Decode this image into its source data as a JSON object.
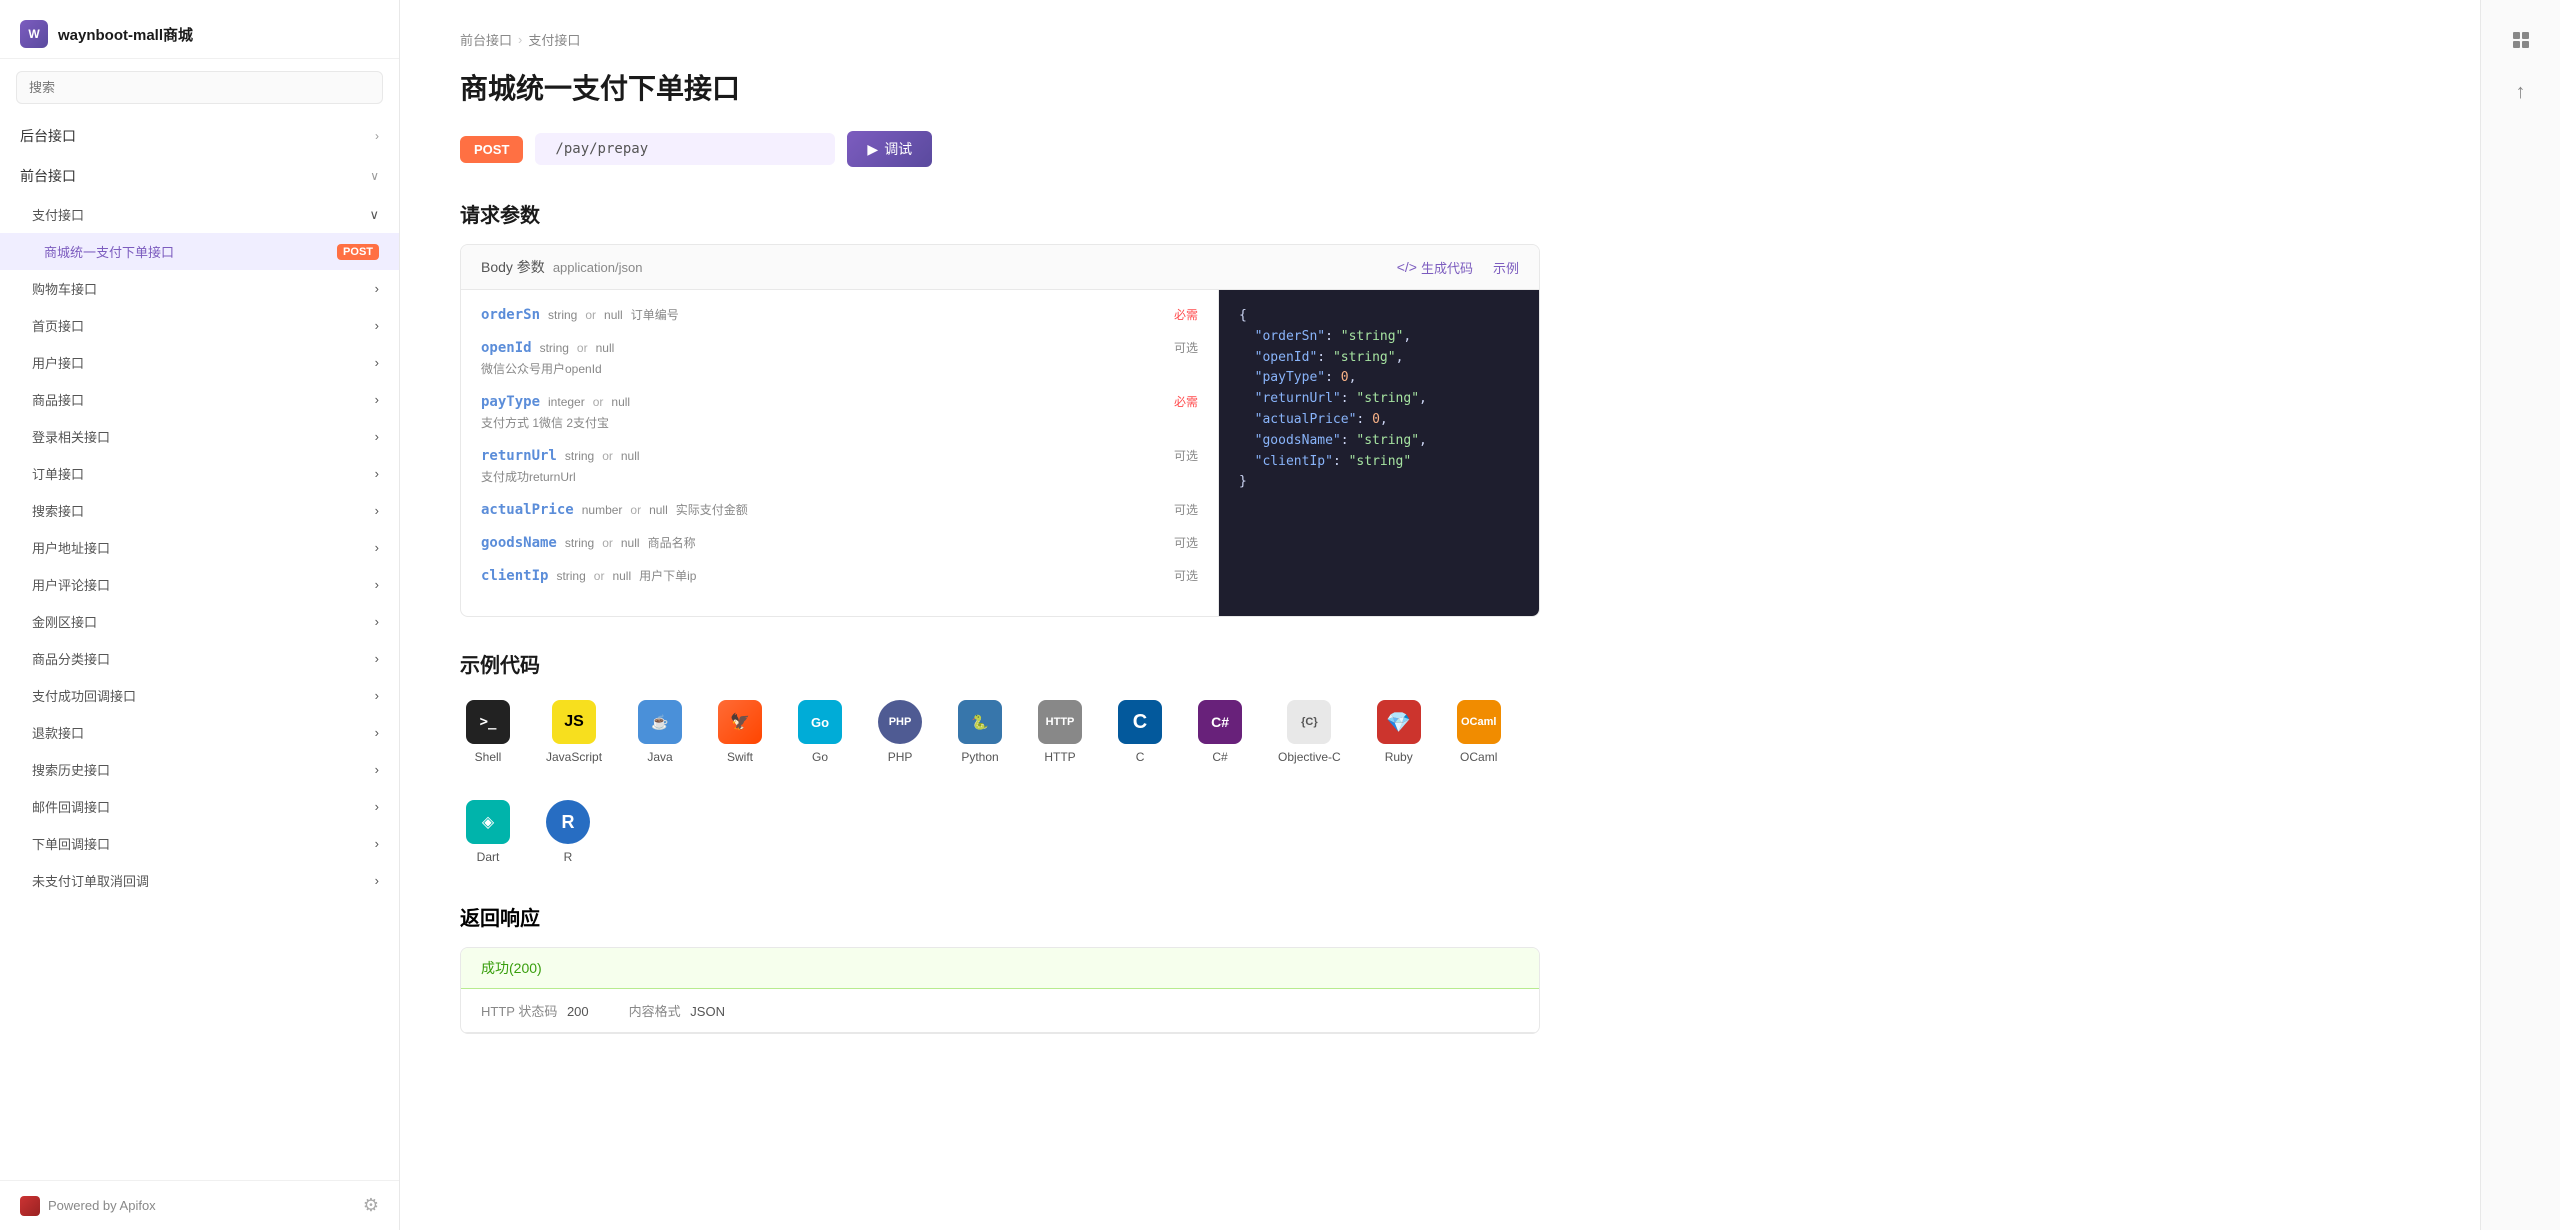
{
  "sidebar": {
    "title": "waynboot-mall商城",
    "logo_text": "W",
    "search_placeholder": "搜索",
    "nav_items": [
      {
        "label": "后台接口",
        "type": "top",
        "expanded": false
      },
      {
        "label": "前台接口",
        "type": "top",
        "expanded": true
      },
      {
        "label": "支付接口",
        "type": "sub",
        "expanded": true
      },
      {
        "label": "商城统一支付下单接口",
        "type": "leaf",
        "method": "POST"
      },
      {
        "label": "购物车接口",
        "type": "sub",
        "expanded": false
      },
      {
        "label": "首页接口",
        "type": "sub",
        "expanded": false
      },
      {
        "label": "用户接口",
        "type": "sub",
        "expanded": false
      },
      {
        "label": "商品接口",
        "type": "sub",
        "expanded": false
      },
      {
        "label": "登录相关接口",
        "type": "sub",
        "expanded": false
      },
      {
        "label": "订单接口",
        "type": "sub",
        "expanded": false
      },
      {
        "label": "搜索接口",
        "type": "sub",
        "expanded": false
      },
      {
        "label": "用户地址接口",
        "type": "sub",
        "expanded": false
      },
      {
        "label": "用户评论接口",
        "type": "sub",
        "expanded": false
      },
      {
        "label": "金刚区接口",
        "type": "sub",
        "expanded": false
      },
      {
        "label": "商品分类接口",
        "type": "sub",
        "expanded": false
      },
      {
        "label": "支付成功回调接口",
        "type": "sub",
        "expanded": false
      },
      {
        "label": "退款接口",
        "type": "sub",
        "expanded": false
      },
      {
        "label": "搜索历史接口",
        "type": "sub",
        "expanded": false
      },
      {
        "label": "邮件回调接口",
        "type": "sub",
        "expanded": false
      },
      {
        "label": "下单回调接口",
        "type": "sub",
        "expanded": false
      },
      {
        "label": "未支付订单取消回调",
        "type": "sub",
        "expanded": false
      }
    ],
    "footer": {
      "brand": "Powered by Apifox",
      "logo": "A"
    }
  },
  "breadcrumb": {
    "items": [
      "前台接口",
      "支付接口"
    ]
  },
  "page": {
    "title": "商城统一支付下单接口",
    "method": "POST",
    "url": "/pay/prepay",
    "debug_label": "调试"
  },
  "request_params": {
    "section_title": "请求参数",
    "body_label": "Body 参数",
    "content_type": "application/json",
    "generate_code_label": "生成代码",
    "example_label": "示例",
    "fields": [
      {
        "name": "orderSn",
        "type": "string",
        "nullable": true,
        "desc": "订单编号",
        "required": true
      },
      {
        "name": "openId",
        "type": "string",
        "nullable": true,
        "sub_desc": "微信公众号用户openId",
        "required": false
      },
      {
        "name": "payType",
        "type": "integer",
        "nullable": true,
        "desc": "",
        "sub_desc": "支付方式 1微信 2支付宝",
        "required": true
      },
      {
        "name": "returnUrl",
        "type": "string",
        "nullable": true,
        "sub_desc": "支付成功returnUrl",
        "required": false
      },
      {
        "name": "actualPrice",
        "type": "number",
        "nullable": true,
        "desc": "实际支付金额",
        "required": false
      },
      {
        "name": "goodsName",
        "type": "string",
        "nullable": true,
        "desc": "商品名称",
        "required": false
      },
      {
        "name": "clientIp",
        "type": "string",
        "nullable": true,
        "desc": "用户下单ip",
        "required": false
      }
    ],
    "example_json": "{\n  \"orderSn\": \"string\",\n  \"openId\": \"string\",\n  \"payType\": 0,\n  \"returnUrl\": \"string\",\n  \"actualPrice\": 0,\n  \"goodsName\": \"string\",\n  \"clientIp\": \"string\"\n}"
  },
  "code_examples": {
    "section_title": "示例代码",
    "items": [
      {
        "label": "Shell",
        "icon": ">_",
        "icon_type": "shell"
      },
      {
        "label": "JavaScript",
        "icon": "JS",
        "icon_type": "js"
      },
      {
        "label": "Java",
        "icon": "☕",
        "icon_type": "java"
      },
      {
        "label": "Swift",
        "icon": "◈",
        "icon_type": "swift"
      },
      {
        "label": "Go",
        "icon": "Go",
        "icon_type": "go"
      },
      {
        "label": "PHP",
        "icon": "PHP",
        "icon_type": "php"
      },
      {
        "label": "Python",
        "icon": "🐍",
        "icon_type": "python"
      },
      {
        "label": "HTTP",
        "icon": "HTTP",
        "icon_type": "http"
      },
      {
        "label": "C",
        "icon": "C",
        "icon_type": "c"
      },
      {
        "label": "C#",
        "icon": "C#",
        "icon_type": "csharp"
      },
      {
        "label": "Objective-C",
        "icon": "{C}",
        "icon_type": "objc"
      },
      {
        "label": "Ruby",
        "icon": "◆",
        "icon_type": "ruby"
      },
      {
        "label": "OCaml",
        "icon": "OCaml",
        "icon_type": "ocaml"
      },
      {
        "label": "Dart",
        "icon": "◈",
        "icon_type": "dart"
      },
      {
        "label": "R",
        "icon": "R",
        "icon_type": "r"
      }
    ]
  },
  "response": {
    "section_title": "返回响应",
    "success_label": "成功(200)",
    "http_status_label": "HTTP 状态码",
    "http_status_value": "200",
    "content_type_label": "内容格式",
    "content_type_value": "JSON"
  },
  "right_panel": {
    "grid_icon": "⊞",
    "arrow_icon": "↑"
  }
}
